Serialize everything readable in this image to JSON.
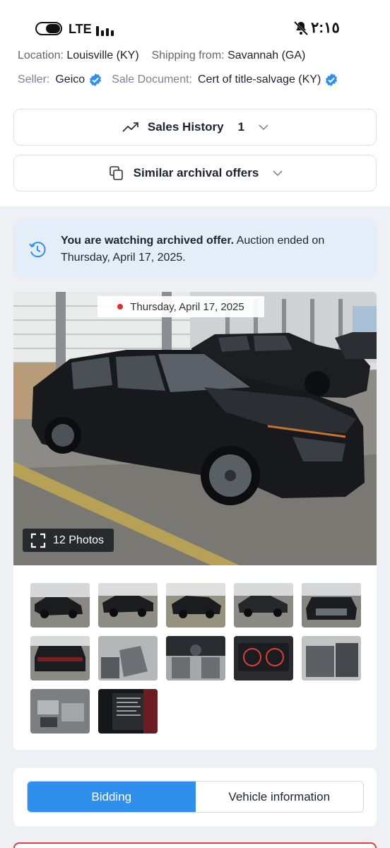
{
  "status_bar": {
    "network": "LTE",
    "time": "٢:١٥"
  },
  "listing": {
    "location_label": "Location:",
    "location_value": "Louisville (KY)",
    "shipping_label": "Shipping from:",
    "shipping_value": "Savannah (GA)",
    "seller_label": "Seller:",
    "seller_value": "Geico",
    "sale_doc_label": "Sale Document:",
    "sale_doc_value": "Cert of title-salvage (KY)"
  },
  "sales_history": {
    "label": "Sales History",
    "count": "1"
  },
  "similar_offers": {
    "label": "Similar archival offers"
  },
  "banner": {
    "bold_text": "You are watching archived offer.",
    "text": " Auction ended on Thursday, April 17, 2025."
  },
  "gallery": {
    "date": "Thursday, April 17, 2025",
    "photos_label": "12 Photos",
    "thumbnails": [
      "car-front-left",
      "car-left-side",
      "car-left-rear",
      "car-right-front",
      "car-front-damage",
      "car-rear",
      "interior-front-seats",
      "dashboard",
      "instrument-cluster",
      "rear-seats",
      "engine-bay",
      "vin-label"
    ]
  },
  "tabs": {
    "bidding": "Bidding",
    "vehicle_info": "Vehicle information"
  },
  "colors": {
    "accent": "#2f8fec",
    "banner_bg": "#e3eef9",
    "verified": "#2f8fec",
    "date_dot": "#d9342b"
  }
}
